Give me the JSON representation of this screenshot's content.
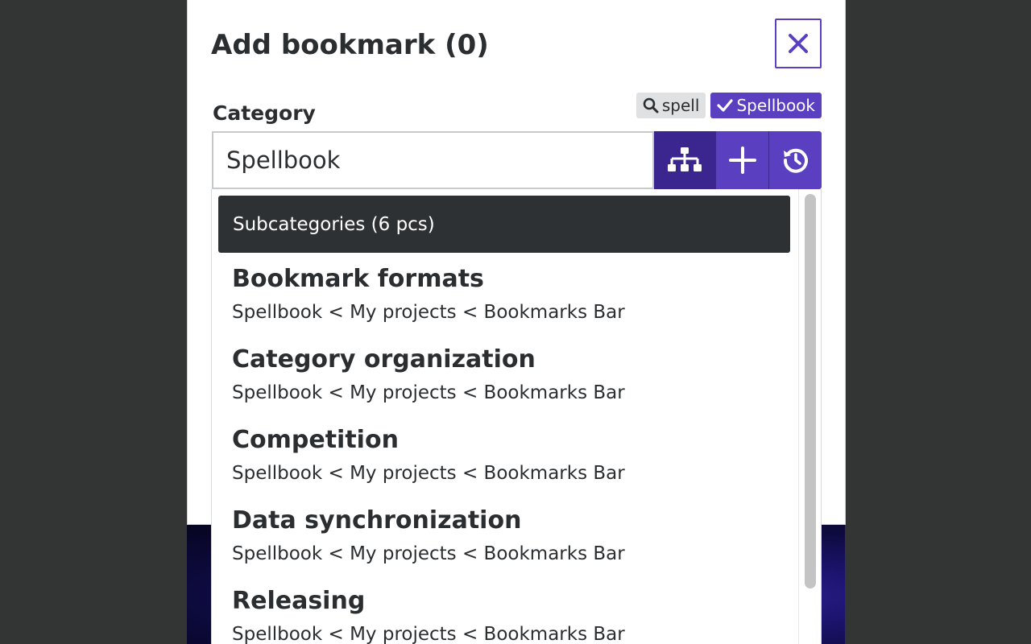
{
  "modal": {
    "title": "Add bookmark (0)",
    "close_icon": "close-icon"
  },
  "category": {
    "label": "Category",
    "value": "Spellbook",
    "chips": {
      "search_icon": "search-icon",
      "search_term": "spell",
      "selected_icon": "check-icon",
      "selected": "Spellbook"
    },
    "buttons": [
      {
        "icon": "hierarchy-icon",
        "active": true
      },
      {
        "icon": "plus-icon",
        "active": false
      },
      {
        "icon": "history-icon",
        "active": false
      }
    ]
  },
  "dropdown": {
    "header": "Subcategories (6 pcs)",
    "items": [
      {
        "title": "Bookmark formats",
        "path": "Spellbook < My projects < Bookmarks Bar"
      },
      {
        "title": "Category organization",
        "path": "Spellbook < My projects < Bookmarks Bar"
      },
      {
        "title": "Competition",
        "path": "Spellbook < My projects < Bookmarks Bar"
      },
      {
        "title": "Data synchronization",
        "path": "Spellbook < My projects < Bookmarks Bar"
      },
      {
        "title": "Releasing",
        "path": "Spellbook < My projects < Bookmarks Bar"
      }
    ]
  },
  "colors": {
    "accent": "#5a3fc0",
    "accent_dark": "#3b2690",
    "header_bg": "#2e3133"
  }
}
